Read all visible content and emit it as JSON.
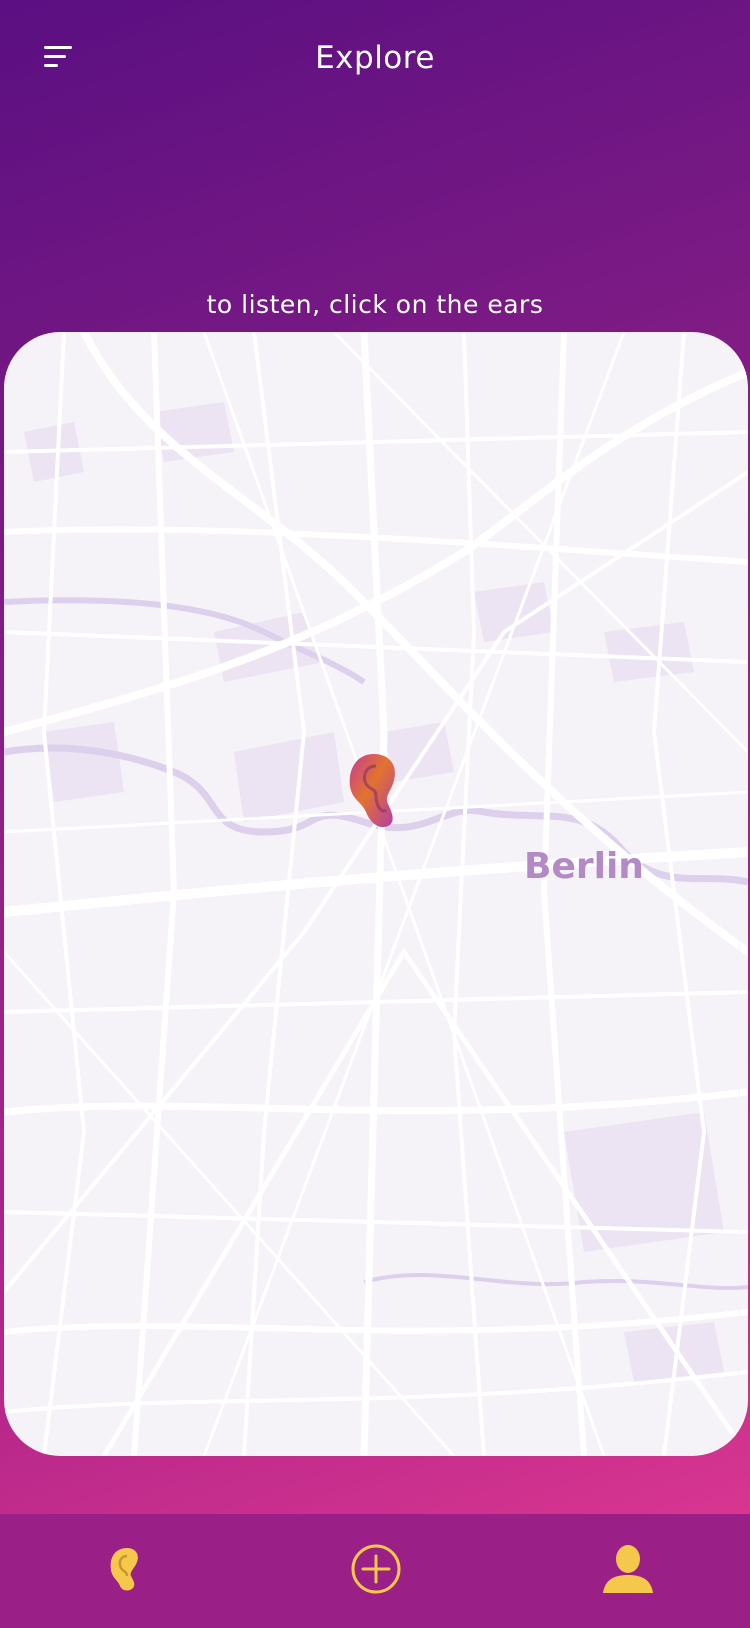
{
  "header": {
    "title": "Explore",
    "menu_icon": "hamburger-menu-icon"
  },
  "hint": {
    "text": "to listen, click on the ears"
  },
  "map": {
    "city_label": "Berlin",
    "marker_icon": "ear-icon"
  },
  "bottom_nav": {
    "items": [
      {
        "icon": "ear-icon"
      },
      {
        "icon": "add-circle-icon"
      },
      {
        "icon": "user-icon"
      }
    ]
  },
  "colors": {
    "gradient_start": "#5a0f82",
    "gradient_end": "#e23a92",
    "nav_background": "#9a1f86",
    "accent_yellow": "#f5c84c",
    "map_background": "#f5f2f8",
    "city_label": "#b48ac6"
  }
}
